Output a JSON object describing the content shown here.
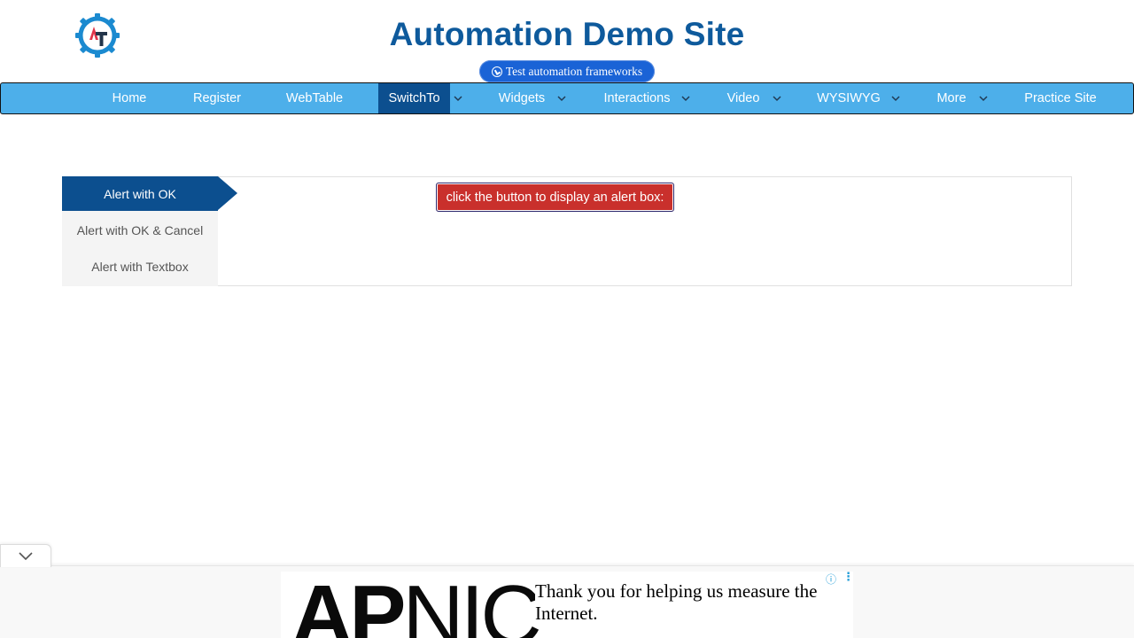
{
  "header": {
    "site_title": "Automation Demo Site",
    "frameworks_pill": "Test automation frameworks",
    "logo_icon": "gear-at-logo-icon",
    "logo_colors": {
      "gear": "#1b8ad0",
      "a": "#e0344a",
      "t": "#22344a"
    }
  },
  "nav": {
    "items": [
      {
        "label": "Home"
      },
      {
        "label": "Register"
      },
      {
        "label": "WebTable"
      },
      {
        "label": "SwitchTo",
        "active": true
      },
      {
        "label": "Widgets"
      },
      {
        "label": "Interactions"
      },
      {
        "label": "Video"
      },
      {
        "label": "WYSIWYG"
      },
      {
        "label": "More"
      },
      {
        "label": "Practice Site"
      }
    ],
    "colors": {
      "bar": "#4dafea",
      "active": "#0c4f8f",
      "text": "#ffffff"
    }
  },
  "alerts": {
    "tabs": [
      {
        "label": "Alert with OK",
        "active": true
      },
      {
        "label": "Alert with OK & Cancel"
      },
      {
        "label": "Alert with Textbox"
      }
    ],
    "button_label": "click the button to display an alert box:",
    "button_color": "#c9302c"
  },
  "ad": {
    "logo_text_bold": "AP",
    "logo_text_thin": "NIC",
    "message": "Thank you for helping us measure the Internet.",
    "info_icon": "info-icon",
    "menu_icon": "vertical-dots-icon",
    "collapse_icon": "chevron-down-icon"
  }
}
